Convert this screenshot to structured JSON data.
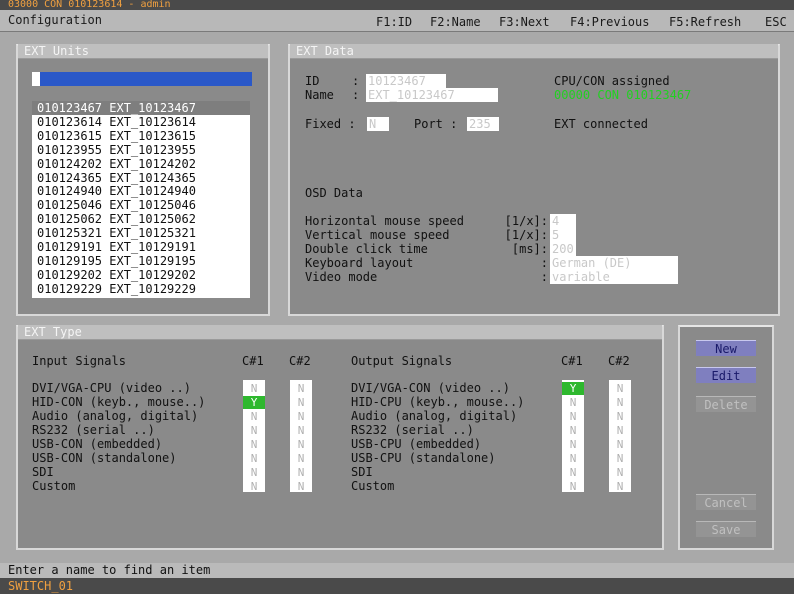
{
  "titlebar": {
    "text": "03000 CON 010123614 - admin"
  },
  "menubar": {
    "config": "Configuration",
    "f1": "F1:ID",
    "f2": "F2:Name",
    "f3": "F3:Next",
    "f4": "F4:Previous",
    "f5": "F5:Refresh",
    "esc": "ESC"
  },
  "ext_units": {
    "title": "EXT Units",
    "search_value": "",
    "items": [
      "010123467 EXT_10123467",
      "010123614 EXT_10123614",
      "010123615 EXT_10123615",
      "010123955 EXT_10123955",
      "010124202 EXT_10124202",
      "010124365 EXT_10124365",
      "010124940 EXT_10124940",
      "010125046 EXT_10125046",
      "010125062 EXT_10125062",
      "010125321 EXT_10125321",
      "010129191 EXT_10129191",
      "010129195 EXT_10129195",
      "010129202 EXT_10129202",
      "010129229 EXT_10129229"
    ],
    "selected_index": 0
  },
  "ext_data": {
    "title": "EXT Data",
    "id_label": "ID",
    "name_label": "Name",
    "colon": ":",
    "id_value": "10123467",
    "name_value": "EXT_10123467",
    "fixed_label": "Fixed :",
    "fixed_value": "N",
    "port_label": "Port :",
    "port_value": "235",
    "assigned_label": "CPU/CON assigned",
    "assigned_value": "00000 CON 010123467",
    "connected_text": "EXT connected",
    "osd_title": "OSD Data",
    "osd": [
      {
        "label": "Horizontal mouse speed",
        "unit": "[1/x]:",
        "value": "4"
      },
      {
        "label": "Vertical mouse speed",
        "unit": "[1/x]:",
        "value": "5"
      },
      {
        "label": "Double click time",
        "unit": "[ms]:",
        "value": "200"
      },
      {
        "label": "Keyboard layout",
        "unit": ":",
        "value": "German (DE)"
      },
      {
        "label": "Video mode",
        "unit": ":",
        "value": "variable"
      }
    ]
  },
  "ext_type": {
    "title": "EXT Type",
    "input_header": "Input Signals",
    "output_header": "Output Signals",
    "c1": "C#1",
    "c2": "C#2",
    "inputs": [
      {
        "label": "DVI/VGA-CPU (video ..)",
        "c1": "N",
        "c2": "N"
      },
      {
        "label": "HID-CON (keyb., mouse..)",
        "c1": "Y",
        "c2": "N"
      },
      {
        "label": "Audio (analog, digital)",
        "c1": "N",
        "c2": "N"
      },
      {
        "label": "RS232 (serial ..)",
        "c1": "N",
        "c2": "N"
      },
      {
        "label": "USB-CON (embedded)",
        "c1": "N",
        "c2": "N"
      },
      {
        "label": "USB-CON (standalone)",
        "c1": "N",
        "c2": "N"
      },
      {
        "label": "SDI",
        "c1": "N",
        "c2": "N"
      },
      {
        "label": "Custom",
        "c1": "N",
        "c2": "N"
      }
    ],
    "outputs": [
      {
        "label": "DVI/VGA-CON (video ..)",
        "c1": "Y",
        "c2": "N"
      },
      {
        "label": "HID-CPU (keyb., mouse..)",
        "c1": "N",
        "c2": "N"
      },
      {
        "label": "Audio (analog, digital)",
        "c1": "N",
        "c2": "N"
      },
      {
        "label": "RS232 (serial ..)",
        "c1": "N",
        "c2": "N"
      },
      {
        "label": "USB-CPU (embedded)",
        "c1": "N",
        "c2": "N"
      },
      {
        "label": "USB-CPU (standalone)",
        "c1": "N",
        "c2": "N"
      },
      {
        "label": "SDI",
        "c1": "N",
        "c2": "N"
      },
      {
        "label": "Custom",
        "c1": "N",
        "c2": "N"
      }
    ]
  },
  "buttons": {
    "new": "New",
    "edit": "Edit",
    "delete": "Delete",
    "cancel": "Cancel",
    "save": "Save"
  },
  "status": {
    "text": "Enter a name to find an item"
  },
  "bottombar": {
    "text": "SWITCH_01"
  }
}
